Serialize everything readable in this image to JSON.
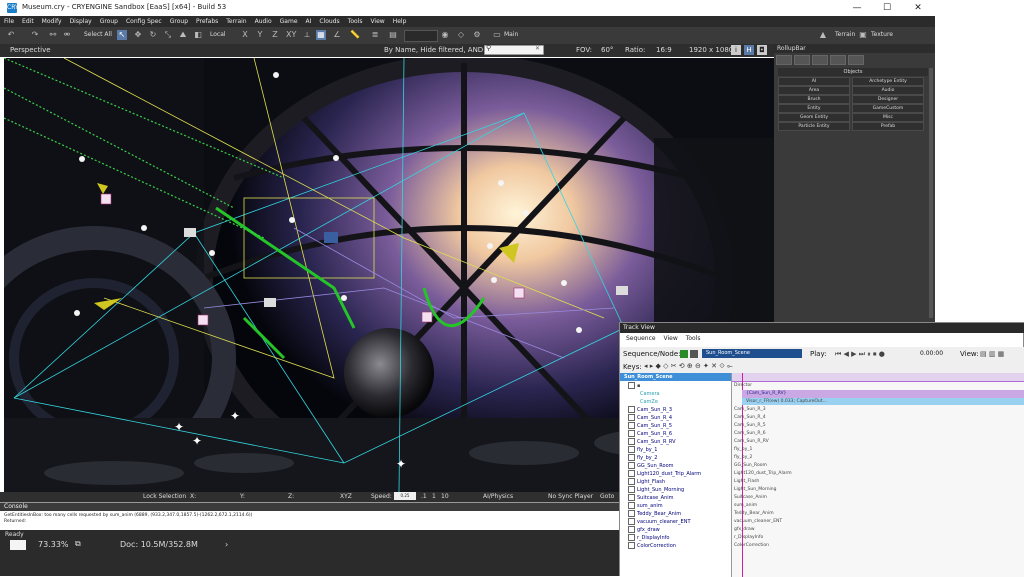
{
  "window": {
    "title": "Museum.cry - CRYENGINE Sandbox [EaaS] [x64] - Build 53",
    "app_icon_text": "CRY",
    "minimize": "—",
    "maximize": "☐",
    "close": "✕"
  },
  "menu": [
    "File",
    "Edit",
    "Modify",
    "Display",
    "Group",
    "Config Spec",
    "Group",
    "Prefabs",
    "Terrain",
    "Audio",
    "Game",
    "AI",
    "Clouds",
    "Tools",
    "View",
    "Help"
  ],
  "toolbar": {
    "select_label": "Select All",
    "coord_label": "Local",
    "axes": [
      "X",
      "Y",
      "Z",
      "XY"
    ],
    "main_label": "Main",
    "terrain_label": "Terrain",
    "texture_label": "Texture"
  },
  "viewport": {
    "name": "Perspective",
    "filter_text": "By Name, Hide filtered, AND",
    "fov_label": "FOV:",
    "fov_value": "60°",
    "ratio_label": "Ratio:",
    "ratio_value": "16:9",
    "resolution": "1920 x 1080",
    "info_btn": "i",
    "h_btn": "H"
  },
  "vpstatus": {
    "lock_selection": "Lock Selection",
    "x_label": "X:",
    "y_label": "Y:",
    "z_label": "Z:",
    "xyz": "XYZ",
    "speed_label": "Speed:",
    "speed_value": "0.25",
    "speed_1": ".1",
    "speed_2": "1",
    "speed_3": "10",
    "ai_physics": "AI/Physics",
    "sync_player": "No Sync Player",
    "goto": "Goto"
  },
  "console": {
    "title": "Console",
    "lines": [
      "GetEntitiesInBox: too many cells requested by sum_anim (6889, (933.2,347.0,1857.5)-(1262.2,672.1,2114.6))",
      "Returned:"
    ]
  },
  "status": {
    "ready": "Ready",
    "zoom": "73.33%",
    "doc": "Doc: 10.5M/352.8M",
    "arrow": "›"
  },
  "rollup": {
    "title": "RollupBar",
    "objects_header": "Objects",
    "buttons": [
      "AI",
      "Archetype Entity",
      "Area",
      "Audio",
      "Brush",
      "Designer",
      "Entity",
      "GameCustom",
      "Geom Entity",
      "Misc",
      "Particle Entity",
      "Prefab"
    ]
  },
  "trackview": {
    "title": "Track View",
    "menu": [
      "Sequence",
      "View",
      "Tools"
    ],
    "sequence_label": "Sequence/Node:",
    "sequence_value": "Sun_Room_Scene",
    "play_label": "Play:",
    "time_value": "0.00:00",
    "view_label": "View:",
    "keys_label": "Keys:",
    "tree_root": "Sun_Room_Scene",
    "tree": [
      "Camera",
      "CamZe",
      "Cam_Sun_R_3",
      "Cam_Sun_R_4",
      "Cam_Sun_R_5",
      "Cam_Sun_R_6",
      "Cam_Sun_R_RV",
      "fly_by_1",
      "fly_by_2",
      "GG_Sun_Room",
      "Light120_dust_Trip_Alarm",
      "Light_Flash",
      "Light_Sun_Morning",
      "Suitcase_Anim",
      "sum_anim",
      "Teddy_Bear_Anim",
      "vacuum_cleaner_ENT",
      "gfx_draw",
      "r_DisplayInfo",
      "ColorCorrection"
    ],
    "lanes": [
      "Director",
      "{Cam_Sun_R_RV}",
      "Visor_r_FR(ew) 0.033; CaptureOut...",
      "Cam_Sun_R_3",
      "Cam_Sun_R_4",
      "Cam_Sun_R_5",
      "Cam_Sun_R_6",
      "Cam_Sun_R_RV",
      "fly_by_1",
      "fly_by_2",
      "GG_Sun_Room",
      "Light120_dust_Trip_Alarm",
      "Light_Flash",
      "Light_Sun_Morning",
      "Suitcase_Anim",
      "sum_anim",
      "Teddy_Bear_Anim",
      "vacuum_cleaner_ENT",
      "gfx_draw",
      "r_DisplayInfo",
      "ColorCorrection"
    ]
  },
  "colors": {
    "accent": "#5a7ba8",
    "track_highlight": "#3f8fd8",
    "timeline_purple": "#b06bd6",
    "tree_blue": "#00007a"
  }
}
